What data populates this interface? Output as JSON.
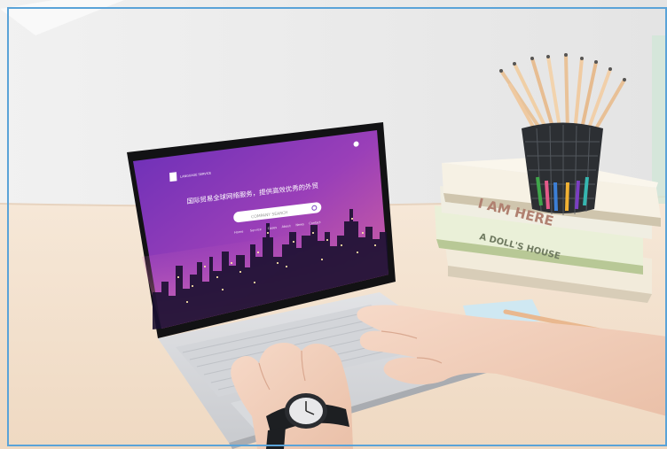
{
  "laptop_screen": {
    "logo_text": "LANGUAGE SERVICE",
    "headline": "国际贸易全球网络服务，提供高效优秀的外贸",
    "search_placeholder": "COMPANY SEARCH",
    "nav_items": [
      "Home",
      "Service",
      "Cases",
      "About",
      "News",
      "Contact"
    ]
  },
  "books": {
    "book_1": "I AM HERE",
    "book_2": "A DOLL'S HOUSE"
  },
  "colors": {
    "frame_border": "#5aa3d8",
    "wall": "#ececec",
    "desk": "#f4e2d0",
    "screen_purple": "#7b3fc2",
    "screen_pink": "#d8659f"
  }
}
